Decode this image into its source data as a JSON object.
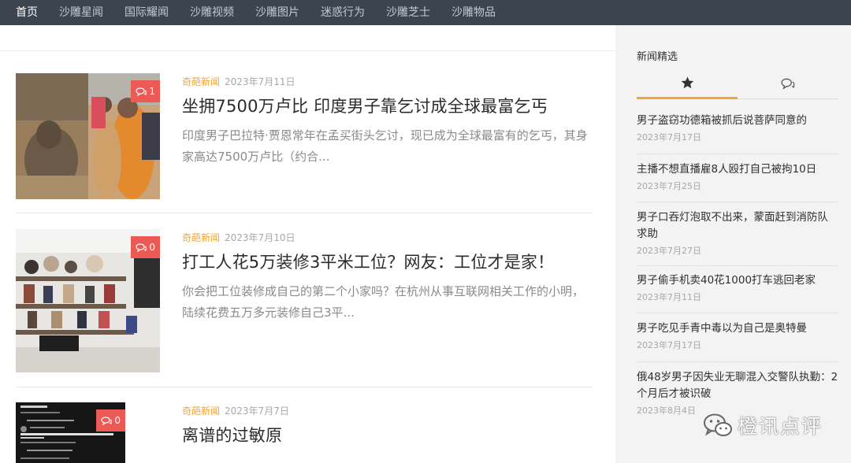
{
  "nav": {
    "items": [
      {
        "label": "首页",
        "active": true
      },
      {
        "label": "沙雕星闻",
        "active": false
      },
      {
        "label": "国际耀闻",
        "active": false
      },
      {
        "label": "沙雕视频",
        "active": false
      },
      {
        "label": "沙雕图片",
        "active": false
      },
      {
        "label": "迷惑行为",
        "active": false
      },
      {
        "label": "沙雕芝士",
        "active": false
      },
      {
        "label": "沙雕物品",
        "active": false
      }
    ]
  },
  "articles": [
    {
      "category": "奇葩新闻",
      "date": "2023年7月11日",
      "title": "坐拥7500万卢比 印度男子靠乞讨成全球最富乞丐",
      "excerpt": "印度男子巴拉特·贾恩常年在孟买街头乞讨，现已成为全球最富有的乞丐，其身家高达7500万卢比（约合...",
      "comments": "1",
      "image": "beggar-photo"
    },
    {
      "category": "奇葩新闻",
      "date": "2023年7月10日",
      "title": "打工人花5万装修3平米工位？网友：工位才是家！",
      "excerpt": "你会把工位装修成自己的第二个小家吗？在杭州从事互联网相关工作的小明，陆续花费五万多元装修自己3平...",
      "comments": "0",
      "image": "workstation-photo"
    },
    {
      "category": "奇葩新闻",
      "date": "2023年7月7日",
      "title": "离谱的过敏原",
      "excerpt": "",
      "comments": "0",
      "image": "chat-screenshot"
    }
  ],
  "sidebar": {
    "title": "新闻精选",
    "tabs": [
      {
        "icon": "star-icon"
      },
      {
        "icon": "comments-icon"
      }
    ],
    "items": [
      {
        "title": "男子盗窃功德箱被抓后说菩萨同意的",
        "date": "2023年7月17日"
      },
      {
        "title": "主播不想直播雇8人殴打自己被拘10日",
        "date": "2023年7月25日"
      },
      {
        "title": "男子口吞灯泡取不出来，蒙面赶到消防队求助",
        "date": "2023年7月27日"
      },
      {
        "title": "男子偷手机卖40花1000打车逃回老家",
        "date": "2023年7月11日"
      },
      {
        "title": "男子吃见手青中毒以为自己是奥特曼",
        "date": "2023年7月17日"
      },
      {
        "title": "俄48岁男子因失业无聊混入交警队执勤：2个月后才被识破",
        "date": "2023年8月4日"
      }
    ]
  },
  "watermark": {
    "text": "橙讯点评"
  },
  "colors": {
    "nav_bg": "#3c4450",
    "accent": "#f0a53a",
    "badge": "#ec5a55",
    "sidebar_bg": "#f3f3f3"
  }
}
